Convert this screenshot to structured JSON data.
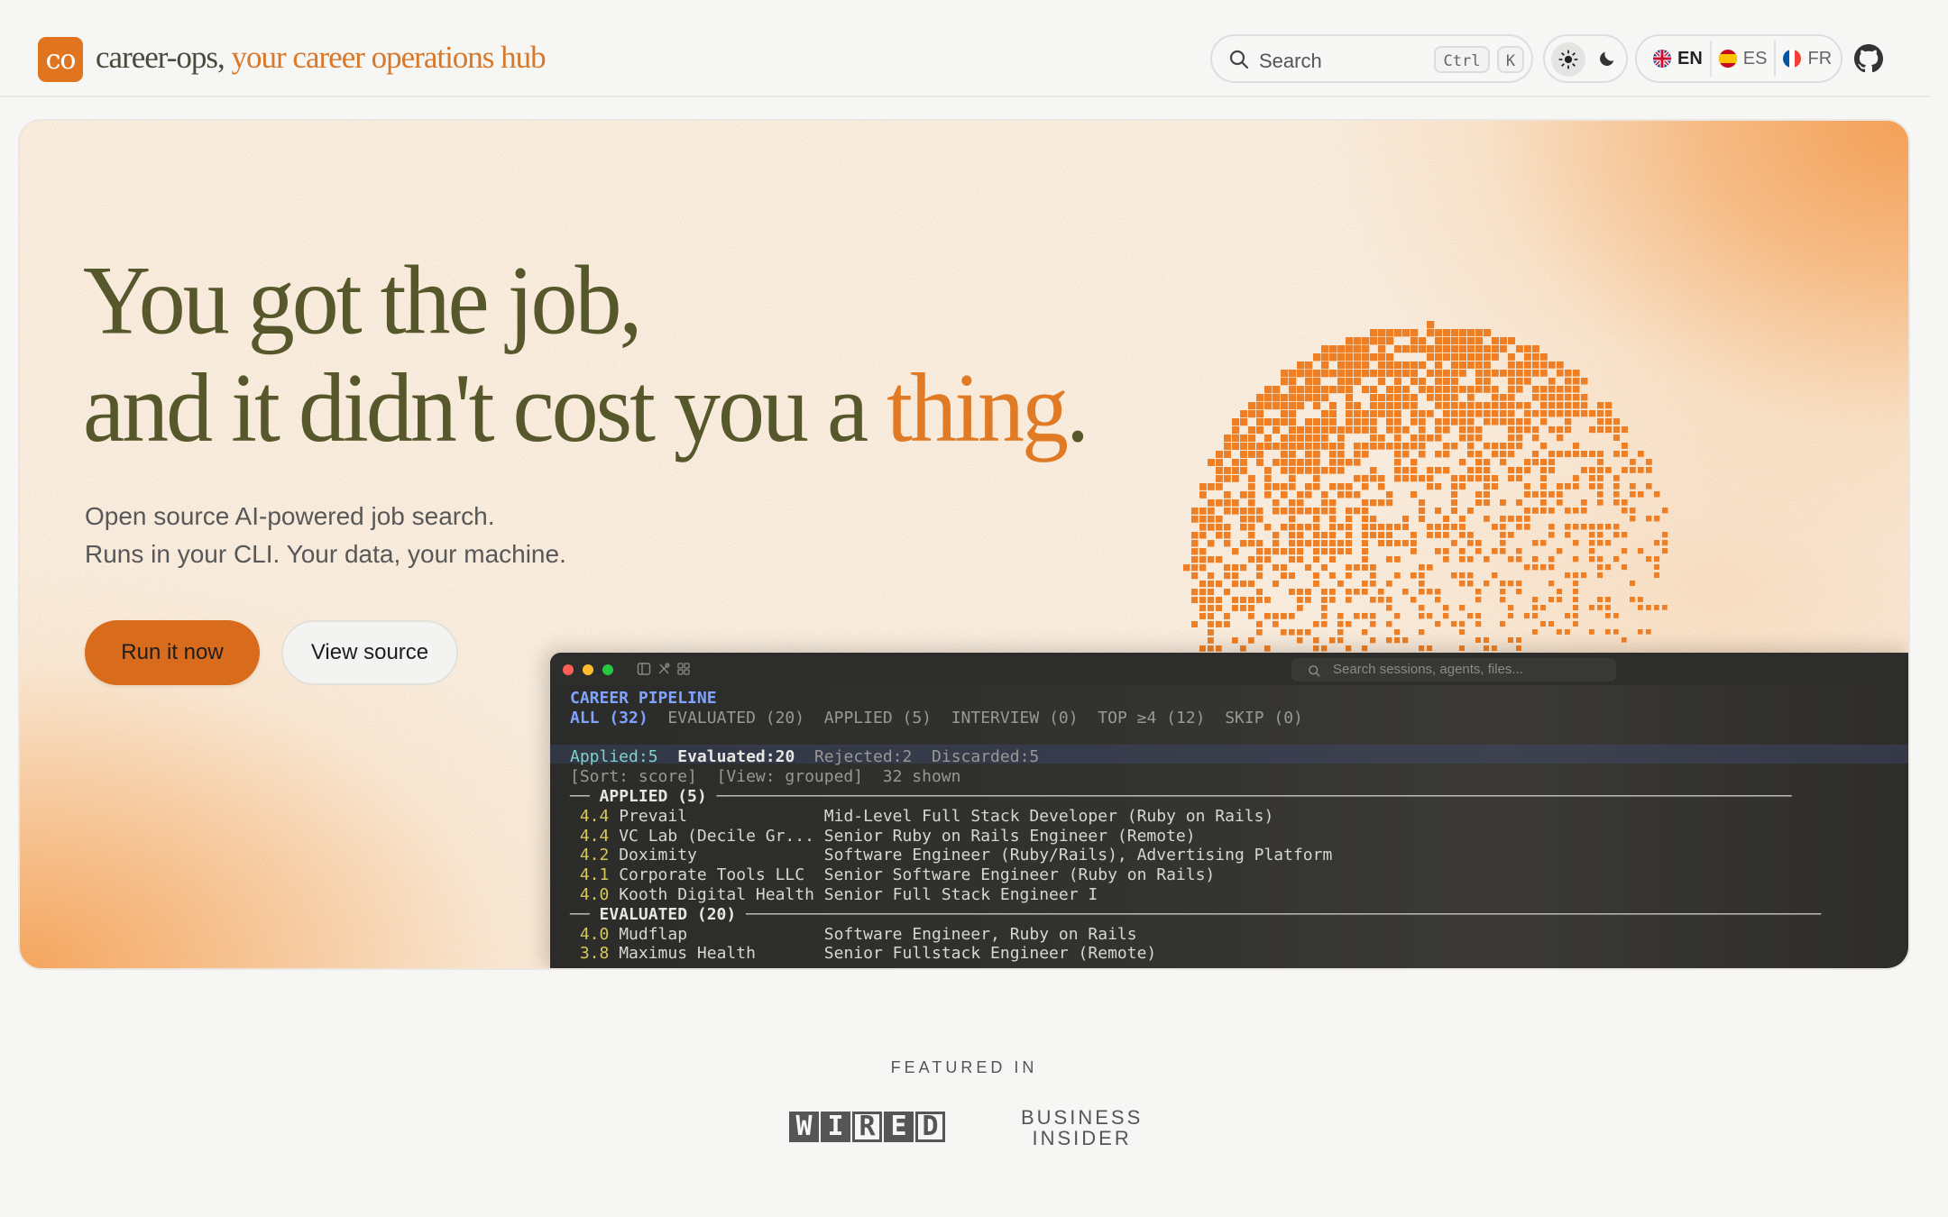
{
  "header": {
    "logo_text": "co",
    "brand_name": "career-ops,",
    "brand_tagline": " your career operations hub",
    "search": {
      "label": "Search",
      "shortcut_mod": "Ctrl",
      "shortcut_key": "K"
    },
    "theme": {
      "light_icon": "sun-icon",
      "dark_icon": "moon-icon",
      "selected": "light"
    },
    "languages": [
      {
        "code": "EN",
        "flag": "uk-flag-icon",
        "active": true
      },
      {
        "code": "ES",
        "flag": "spain-flag-icon",
        "active": false
      },
      {
        "code": "FR",
        "flag": "france-flag-icon",
        "active": false
      }
    ],
    "github_icon": "github-icon"
  },
  "hero": {
    "headline_line1": "You got the job,",
    "headline_line2_pre": "and it didn't cost you a ",
    "headline_accent": "thing",
    "headline_end": ".",
    "subtitle_line1": "Open source AI-powered job search.",
    "subtitle_line2": "Runs in your CLI. Your data, your machine.",
    "primary_button": "Run it now",
    "secondary_button": "View source",
    "colors": {
      "accent": "#e07a24",
      "headline": "#56582c",
      "button": "#d96c1c"
    }
  },
  "terminal": {
    "search_placeholder": "Search sessions, agents, files...",
    "title": "CAREER PIPELINE",
    "tabs": [
      {
        "label": "ALL (32)",
        "active": true
      },
      {
        "label": "EVALUATED (20)",
        "active": false
      },
      {
        "label": "APPLIED (5)",
        "active": false
      },
      {
        "label": "INTERVIEW (0)",
        "active": false
      },
      {
        "label": "TOP ≥4 (12)",
        "active": false
      },
      {
        "label": "SKIP (0)",
        "active": false
      }
    ],
    "stats": {
      "applied": "Applied:5",
      "evaluated": "Evaluated:20",
      "rejected": "Rejected:2",
      "discarded": "Discarded:5"
    },
    "sort_line": "[Sort: score]  [View: grouped]  32 shown",
    "groups": [
      {
        "label": "APPLIED (5)",
        "rows": [
          {
            "score": "4.4",
            "company": "Prevail",
            "role": "Mid-Level Full Stack Developer (Ruby on Rails)"
          },
          {
            "score": "4.4",
            "company": "VC Lab (Decile Gr...",
            "role": "Senior Ruby on Rails Engineer (Remote)"
          },
          {
            "score": "4.2",
            "company": "Doximity",
            "role": "Software Engineer (Ruby/Rails), Advertising Platform"
          },
          {
            "score": "4.1",
            "company": "Corporate Tools LLC",
            "role": "Senior Software Engineer (Ruby on Rails)"
          },
          {
            "score": "4.0",
            "company": "Kooth Digital Health",
            "role": "Senior Full Stack Engineer I"
          }
        ]
      },
      {
        "label": "EVALUATED (20)",
        "rows": [
          {
            "score": "4.0",
            "company": "Mudflap",
            "role": "Software Engineer, Ruby on Rails"
          },
          {
            "score": "3.8",
            "company": "Maximus Health",
            "role": "Senior Fullstack Engineer (Remote)"
          }
        ]
      }
    ]
  },
  "featured": {
    "label": "FEATURED IN",
    "wired_letters": [
      "W",
      "I",
      "R",
      "E",
      "D"
    ],
    "bi_line1": "BUSINESS",
    "bi_line2": "INSIDER"
  }
}
